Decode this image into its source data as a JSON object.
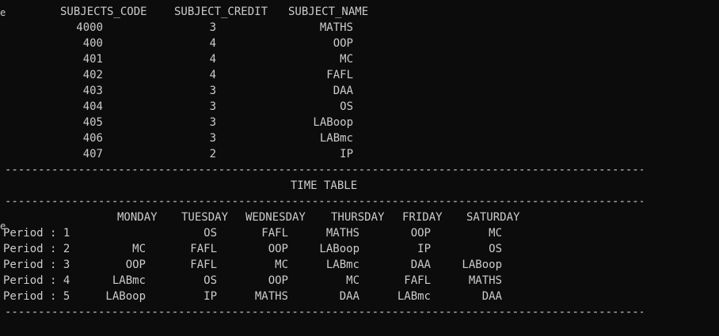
{
  "subjects": {
    "headers": {
      "code": "SUBJECTS_CODE",
      "credit": "SUBJECT_CREDIT",
      "name": "SUBJECT_NAME"
    },
    "rows": [
      {
        "code": "4000",
        "credit": "3",
        "name": "MATHS"
      },
      {
        "code": "400",
        "credit": "4",
        "name": "OOP"
      },
      {
        "code": "401",
        "credit": "4",
        "name": "MC"
      },
      {
        "code": "402",
        "credit": "4",
        "name": "FAFL"
      },
      {
        "code": "403",
        "credit": "3",
        "name": "DAA"
      },
      {
        "code": "404",
        "credit": "3",
        "name": "OS"
      },
      {
        "code": "405",
        "credit": "3",
        "name": "LABoop"
      },
      {
        "code": "406",
        "credit": "3",
        "name": "LABmc"
      },
      {
        "code": "407",
        "credit": "2",
        "name": "IP"
      }
    ]
  },
  "separator": "----------------------------------------------------------------------------------------------------------------------------------",
  "timetable": {
    "title": "TIME TABLE",
    "days": [
      "MONDAY",
      "TUESDAY",
      "WEDNESDAY",
      "THURSDAY",
      "FRIDAY",
      "SATURDAY"
    ],
    "periods": [
      {
        "label": "Period : 1",
        "slots": [
          "",
          "OS",
          "FAFL",
          "MATHS",
          "OOP",
          "MC"
        ]
      },
      {
        "label": "Period : 2",
        "slots": [
          "MC",
          "FAFL",
          "OOP",
          "LABoop",
          "IP",
          "OS"
        ]
      },
      {
        "label": "Period : 3",
        "slots": [
          "OOP",
          "FAFL",
          "MC",
          "LABmc",
          "DAA",
          "LABoop"
        ]
      },
      {
        "label": "Period : 4",
        "slots": [
          "LABmc",
          "OS",
          "OOP",
          "MC",
          "FAFL",
          "MATHS"
        ]
      },
      {
        "label": "Period : 5",
        "slots": [
          "LABoop",
          "IP",
          "MATHS",
          "DAA",
          "LABmc",
          "DAA"
        ]
      }
    ]
  },
  "gutter": {
    "top_mark": "e",
    "mid_mark": "e"
  }
}
